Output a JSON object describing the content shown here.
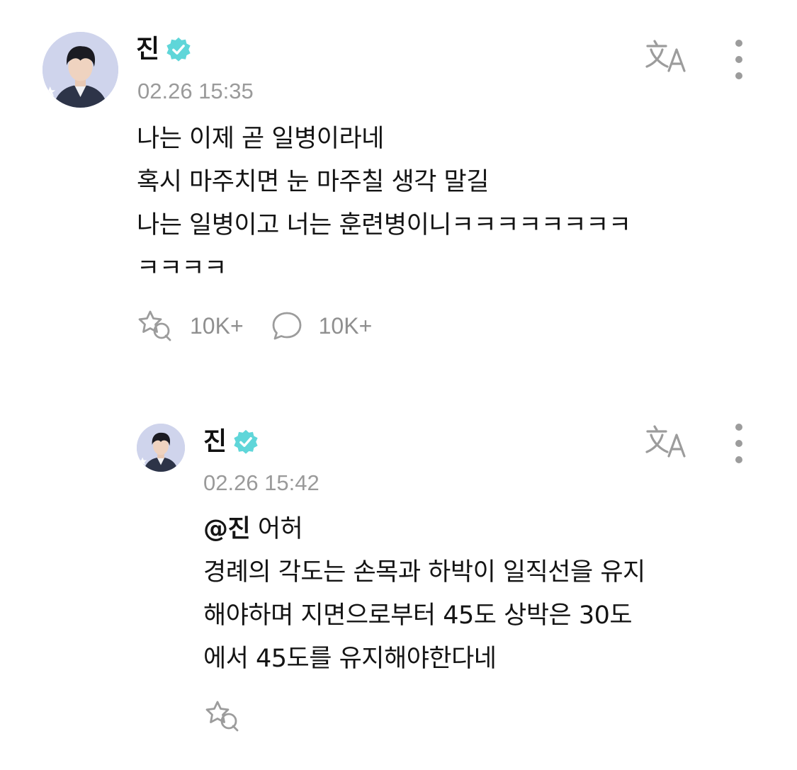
{
  "post": {
    "author": "진",
    "timestamp": "02.26 15:35",
    "lines": [
      "나는 이제 곧 일병이라네",
      "혹시 마주치면 눈 마주칠 생각 말길",
      "나는 일병이고 너는 훈련병이니ㅋㅋㅋㅋㅋㅋㅋㅋ",
      "ㅋㅋㅋㅋ"
    ],
    "like_count": "10K+",
    "comment_count": "10K+"
  },
  "reply": {
    "author": "진",
    "timestamp": "02.26 15:42",
    "mention": "@진",
    "first_line_rest": " 어허",
    "lines": [
      "경례의 각도는 손목과 하박이 일직선을 유지",
      "해야하며 지면으로부터 45도 상박은 30도",
      "에서 45도를 유지해야한다네"
    ]
  },
  "icons": {
    "verified": "verified-badge-icon",
    "translate": "translate-icon",
    "more": "more-vertical-icon",
    "like": "star-hand-like-icon",
    "comment": "speech-bubble-icon"
  },
  "colors": {
    "verified_badge": "#5fd6d9",
    "icon_gray": "#9c9c9c",
    "timestamp_gray": "#9a9a9a"
  }
}
